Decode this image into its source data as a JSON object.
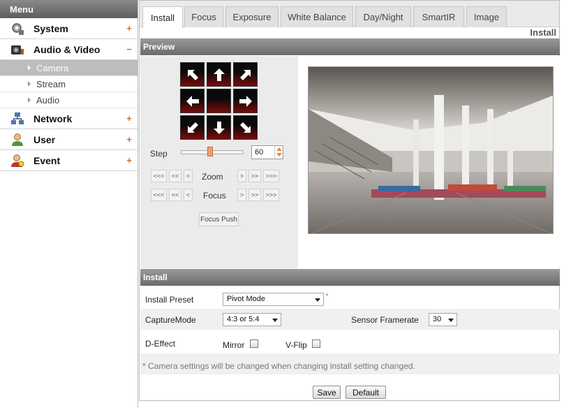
{
  "sidebar": {
    "title": "Menu",
    "items": [
      {
        "label": "System",
        "toggle": "+"
      },
      {
        "label": "Audio & Video",
        "toggle": "−"
      },
      {
        "label": "Network",
        "toggle": "+"
      },
      {
        "label": "User",
        "toggle": "+"
      },
      {
        "label": "Event",
        "toggle": "+"
      }
    ],
    "subitems": [
      {
        "label": "Camera"
      },
      {
        "label": "Stream"
      },
      {
        "label": "Audio"
      }
    ]
  },
  "tabs": [
    {
      "label": "Install"
    },
    {
      "label": "Focus"
    },
    {
      "label": "Exposure"
    },
    {
      "label": "White Balance"
    },
    {
      "label": "Day/Night"
    },
    {
      "label": "SmartIR"
    },
    {
      "label": "Image"
    }
  ],
  "breadcrumb": "Install",
  "preview": {
    "title": "Preview",
    "step_label": "Step",
    "step_value": "60",
    "step_fraction": 0.47,
    "zoom_label": "Zoom",
    "focus_label": "Focus",
    "zoom_buttons": [
      "<<<",
      "<<",
      "<",
      ">",
      ">>",
      ">>>"
    ],
    "focus_buttons": [
      "<<<",
      "<<",
      "<",
      ">",
      ">>",
      ">>>"
    ],
    "focus_push": "Focus Push"
  },
  "install": {
    "title": "Install",
    "preset_label": "Install Preset",
    "preset_value": "Pivot Mode",
    "preset_required": "*",
    "capture_label": "CaptureMode",
    "capture_value": "4:3 or 5:4",
    "framerate_label": "Sensor Framerate",
    "framerate_value": "30",
    "deffect_label": "D-Effect",
    "mirror_label": "Mirror",
    "vflip_label": "V-Flip",
    "note": "* Camera settings will be changed when changing install setting changed.",
    "save_label": "Save",
    "default_label": "Default"
  },
  "colors": {
    "accent": "#d4672a",
    "ptz_red": "#7a0b0b",
    "section_bar": "#7a7a7a"
  }
}
